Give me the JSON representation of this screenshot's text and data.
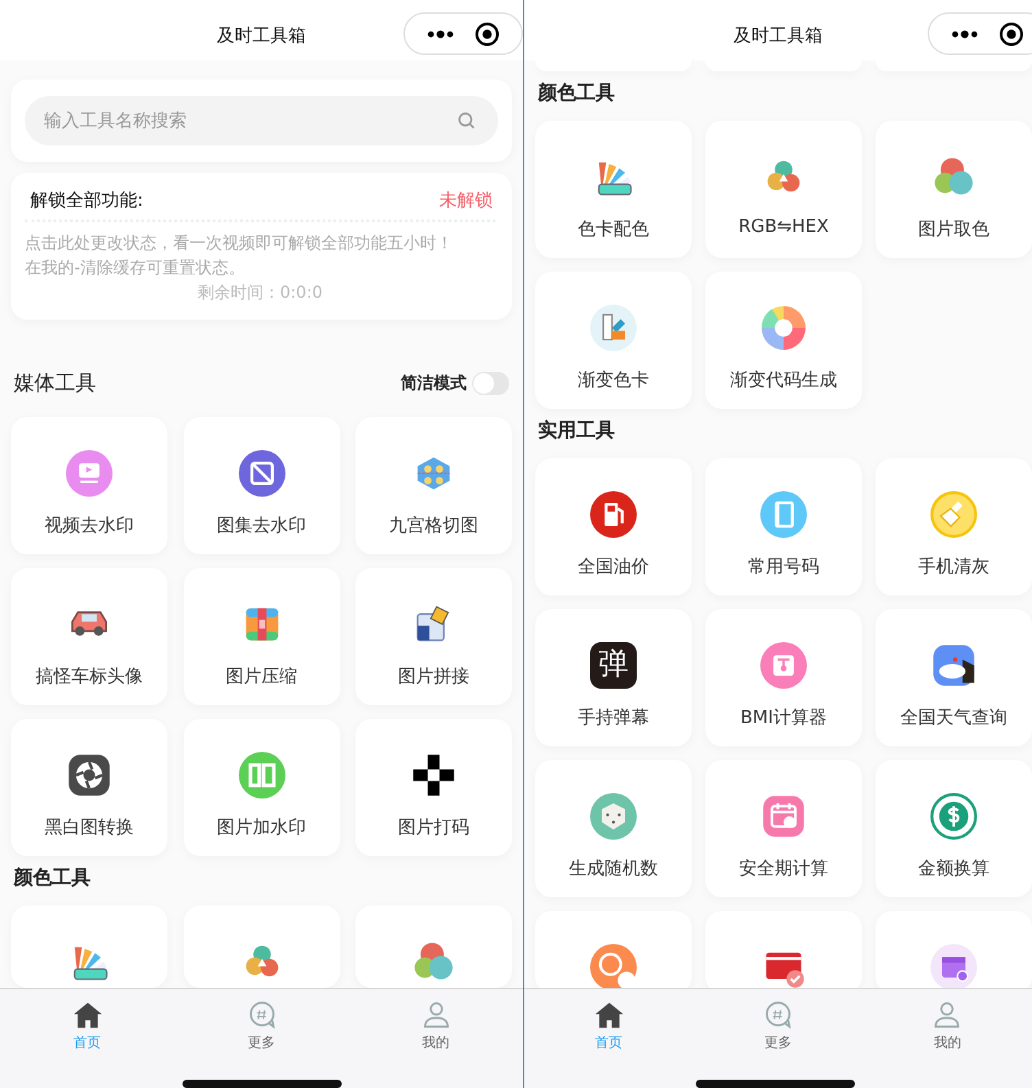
{
  "screens": [
    {
      "title": "及时工具箱",
      "scrolled": false,
      "search": {
        "placeholder": "输入工具名称搜索"
      },
      "unlock": {
        "title": "解锁全部功能:",
        "status": "未解锁",
        "lines": [
          "点击此处更改状态，看一次视频即可解锁全部功能五小时！",
          "在我的-清除缓存可重置状态。"
        ],
        "remaining": "剩余时间：0:0:0"
      },
      "sections": [
        {
          "title": "媒体工具",
          "simple_mode": {
            "label": "简洁模式",
            "on": false
          },
          "tools": [
            {
              "kind": "tool",
              "label": "视频去水印"
            },
            {
              "kind": "tool",
              "label": "图集去水印"
            },
            {
              "kind": "tool",
              "label": "九宫格切图"
            },
            {
              "kind": "tool",
              "label": "搞怪车标头像"
            },
            {
              "kind": "tool",
              "label": "图片压缩"
            },
            {
              "kind": "tool",
              "label": "图片拼接"
            },
            {
              "kind": "tool",
              "label": "黑白图转换"
            },
            {
              "kind": "tool",
              "label": "图片加水印"
            },
            {
              "kind": "tool",
              "label": "图片打码"
            }
          ]
        },
        {
          "title": "颜色工具",
          "tools": [
            {
              "kind": "cut"
            },
            {
              "kind": "cut"
            },
            {
              "kind": "cut"
            }
          ]
        }
      ],
      "tab_bar": [
        {
          "label": "首页",
          "selected": true
        },
        {
          "label": "更多",
          "selected": false
        },
        {
          "label": "我的",
          "selected": false
        }
      ]
    },
    {
      "title": "及时工具箱",
      "scrolled": true,
      "sections": [
        {
          "tools": [
            {
              "kind": "hidden"
            },
            {
              "kind": "hidden"
            },
            {
              "kind": "hidden"
            }
          ]
        },
        {
          "title": "颜色工具",
          "tools": [
            {
              "kind": "tool",
              "label": "色卡配色"
            },
            {
              "kind": "tool",
              "label": "RGB⇋HEX"
            },
            {
              "kind": "tool",
              "label": "图片取色"
            },
            {
              "kind": "tool",
              "label": "渐变色卡"
            },
            {
              "kind": "tool",
              "label": "渐变代码生成"
            }
          ]
        },
        {
          "title": "实用工具",
          "tools": [
            {
              "kind": "tool",
              "label": "全国油价"
            },
            {
              "kind": "tool",
              "label": "常用号码"
            },
            {
              "kind": "tool",
              "label": "手机清灰"
            },
            {
              "kind": "tool",
              "label": "手持弹幕",
              "icon_text": "弹"
            },
            {
              "kind": "tool",
              "label": "BMI计算器"
            },
            {
              "kind": "tool",
              "label": "全国天气查询"
            },
            {
              "kind": "tool",
              "label": "生成随机数"
            },
            {
              "kind": "tool",
              "label": "安全期计算"
            },
            {
              "kind": "tool",
              "label": "金额换算"
            },
            {
              "kind": "cut"
            },
            {
              "kind": "cut"
            },
            {
              "kind": "cut"
            }
          ]
        }
      ],
      "tab_bar": [
        {
          "label": "首页",
          "selected": true
        },
        {
          "label": "更多",
          "selected": false
        },
        {
          "label": "我的",
          "selected": false
        }
      ]
    }
  ]
}
